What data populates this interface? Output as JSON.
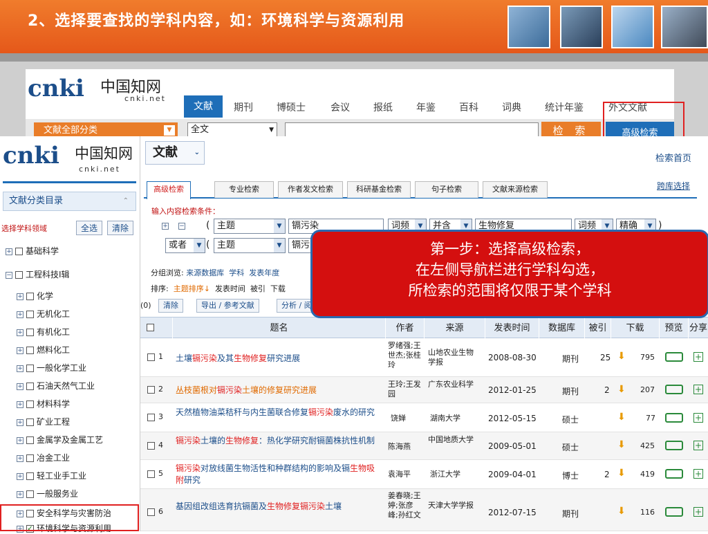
{
  "slide": {
    "title": "2、选择要查找的学科内容，如：环境科学与资源利用"
  },
  "bg_site": {
    "logo": "cnki",
    "logo_cn": "中国知网",
    "logo_url": "cnki.net",
    "nav": [
      "文献",
      "期刊",
      "博硕士",
      "会议",
      "报纸",
      "年鉴",
      "百科",
      "词典",
      "统计年鉴",
      "外文文献"
    ],
    "category_btn": "文献全部分类",
    "field": "全文",
    "search_label": "检 索",
    "advanced": "高级检索"
  },
  "site": {
    "logo": "cnki",
    "logo_cn": "中国知网",
    "logo_url": "cnki.net",
    "doc_label": "文献",
    "home": "检索首页",
    "cross": "跨库选择"
  },
  "sidebar": {
    "title": "文献分类目录",
    "select_field": "选择学科领域",
    "select_all": "全选",
    "clear": "清除",
    "items": [
      "基础科学",
      "工程科技Ⅰ辑",
      "化学",
      "无机化工",
      "有机化工",
      "燃料化工",
      "一般化学工业",
      "石油天然气工业",
      "材料科学",
      "矿业工程",
      "金属学及金属工艺",
      "冶金工业",
      "轻工业手工业",
      "一般服务业",
      "安全科学与灾害防治",
      "环境科学与资源利用"
    ]
  },
  "search_tabs": [
    "高级检索",
    "专业检索",
    "作者发文检索",
    "科研基金检索",
    "句子检索",
    "文献来源检索"
  ],
  "conditions": {
    "label": "输入内容检索条件：",
    "row1": {
      "paren": "(",
      "field": "主题",
      "term": "镉污染",
      "freq": "词频",
      "op": "并含",
      "term2": "生物修复",
      "freq2": "词频",
      "match": "精确",
      "paren_close": ")"
    },
    "row2": {
      "logic": "或者",
      "paren": "(",
      "field": "主题",
      "term": "镉污"
    }
  },
  "browse": {
    "label": "分组浏览:",
    "items": [
      "来源数据库",
      "学科",
      "发表年度"
    ]
  },
  "sort": {
    "label": "排序:",
    "items": [
      "主题排序↓",
      "发表时间",
      "被引",
      "下载"
    ]
  },
  "actions": {
    "count": "0)",
    "clear": "清除",
    "export": "导出 / 参考文献",
    "analyze": "分析 / 阅"
  },
  "callout": {
    "lines": [
      "第一步：选择高级检索，",
      "在左侧导航栏进行学科勾选，",
      "所检索的范围将仅限于某个学科"
    ]
  },
  "table": {
    "headers": [
      "题名",
      "作者",
      "来源",
      "发表时间",
      "数据库",
      "被引",
      "下载",
      "预览",
      "分享"
    ],
    "rows": [
      {
        "num": "1",
        "title": "土壤镉污染及其生物修复研究进展",
        "author": "罗绪强;王世杰;张桂玲",
        "source": "山地农业生物学报",
        "date": "2008-08-30",
        "db": "期刊",
        "cited": "25",
        "downloads": "795"
      },
      {
        "num": "2",
        "title": "丛枝菌根对镉污染土壤的修复研究进展",
        "author": "王玲;王发园",
        "source": "广东农业科学",
        "date": "2012-01-25",
        "db": "期刊",
        "cited": "2",
        "downloads": "207"
      },
      {
        "num": "3",
        "title": "天然植物油菜秸秆与内生菌联合修复镉污染废水的研究",
        "author": "饶婵",
        "source": "湖南大学",
        "date": "2012-05-15",
        "db": "硕士",
        "cited": "",
        "downloads": "77"
      },
      {
        "num": "4",
        "title": "镉污染土壤的生物修复：热化学研究耐镉菌株抗性机制",
        "author": "陈海燕",
        "source": "中国地质大学",
        "date": "2009-05-01",
        "db": "硕士",
        "cited": "",
        "downloads": "425"
      },
      {
        "num": "5",
        "title": "镉污染对放线菌生物活性和种群结构的影响及镉生物吸附研究",
        "author": "袁海平",
        "source": "浙江大学",
        "date": "2009-04-01",
        "db": "博士",
        "cited": "2",
        "downloads": "419"
      },
      {
        "num": "6",
        "title": "基因组改组选育抗镉菌及生物修复镉污染土壤",
        "author": "姜春晓;王婷;张彦峰;孙红文",
        "source": "天津大学学报",
        "date": "2012-07-15",
        "db": "期刊",
        "cited": "",
        "downloads": "116"
      }
    ]
  }
}
